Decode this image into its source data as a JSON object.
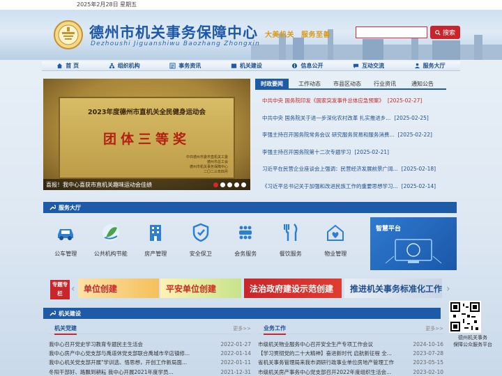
{
  "top": {
    "date": "2025年2月28日 星期五"
  },
  "header": {
    "title": "德州市机关事务保障中心",
    "pinyin": "Dezhoushi Jiguanshiwu Baozhang Zhongxin",
    "slogan1": "大美机关",
    "slogan2": "服务至善",
    "search_placeholder": "",
    "search_label": "搜索"
  },
  "nav": [
    {
      "label": "首 页",
      "icon": "home-icon"
    },
    {
      "label": "组织机构",
      "icon": "org-icon"
    },
    {
      "label": "事务资讯",
      "icon": "news-icon"
    },
    {
      "label": "机关建设",
      "icon": "book-icon"
    },
    {
      "label": "信息公开",
      "icon": "info-icon"
    },
    {
      "label": "互动交流",
      "icon": "chat-icon"
    },
    {
      "label": "服务大厅",
      "icon": "hall-icon"
    }
  ],
  "slider": {
    "plaque_title": "2023年度德州市直机关全民健身运动会",
    "plaque_award": "团体三等奖",
    "plaque_issuer": [
      "中共德州市委市直机关工委",
      "德州市总工会",
      "德州市机关事务保障中心",
      "二〇二三年四月"
    ],
    "caption": "喜报！我中心喜获市直机关趣味运动会佳绩",
    "dots": 5,
    "active_dot": 0
  },
  "news": {
    "tabs": [
      "时政要闻",
      "工作动态",
      "市县区动态",
      "行业资讯",
      "通知公告"
    ],
    "items": [
      {
        "title": "中共中央 国务院印发《国家突发事件总体应急预案》",
        "date": "[2025-02-27]"
      },
      {
        "title": "中共中央 国务院关于进一步深化农村改革 扎实推进乡...",
        "date": "[2025-02-25]"
      },
      {
        "title": "李强主持召开国务院常务会议 研究服务贸易和服务消费...",
        "date": "[2025-02-22]"
      },
      {
        "title": "李强主持召开国务院第十二次专题学习",
        "date": "[2025-02-21]"
      },
      {
        "title": "习近平在民营企业座谈会上强调：民营经济发展前景广阔...",
        "date": "[2025-02-18]"
      },
      {
        "title": "《习近平总书记关于加强和改进民族工作的重要思想学习...",
        "date": "[2025-02-14]"
      }
    ]
  },
  "service_hall": {
    "title": "服务大厅",
    "items": [
      {
        "label": "公车管理",
        "icon": "car-icon"
      },
      {
        "label": "公共机构节能",
        "icon": "energy-icon"
      },
      {
        "label": "房产管理",
        "icon": "building-icon"
      },
      {
        "label": "安全保卫",
        "icon": "shield-icon"
      },
      {
        "label": "会务服务",
        "icon": "meeting-icon"
      },
      {
        "label": "餐饮服务",
        "icon": "dining-icon"
      },
      {
        "label": "物业管理",
        "icon": "property-icon"
      }
    ],
    "smart_title": "智慧平台"
  },
  "banners": {
    "label": "专题专栏",
    "items": [
      "单位创建",
      "平安单位创建",
      "法治政府建设示范创建",
      "推进机关事务标准化工作"
    ]
  },
  "qr": {
    "label1": "德州机关事务",
    "label2": "保障公众服务平台"
  },
  "construction": {
    "title": "机关建设",
    "party": {
      "title": "机关党建",
      "more": "更多>>",
      "items": [
        {
          "title": "我中心召开党史学习教育专题民主生活会",
          "date": "2022-01-27"
        },
        {
          "title": "我中心房产中心党支部与禹道休党支部联合禹城市辛店镇修...",
          "date": "2022-01-14"
        },
        {
          "title": "我中心机关党支部开展\"学训选、悟思想，开创工作新局面...",
          "date": "2022-01-11"
        },
        {
          "title": "冬阳干部好、路飘到耕耘 我中心开展2021年度学员...",
          "date": "2021-12-31"
        }
      ]
    },
    "work": {
      "title": "业务工作",
      "more": "更多>>",
      "items": [
        {
          "title": "市级机关物业服务中心召开安全生产专项工作会议",
          "date": "2024-10-16"
        },
        {
          "title": "【学习贯彻党的二十大精神】奋进新时代 启航新征程 全...",
          "date": "2023-07-28"
        },
        {
          "title": "省机关事务管理局来我市调研行政事业单位房地产管理工作",
          "date": "2023-05-15"
        },
        {
          "title": "市级机关房产事务中心党支部召开2022年度组织生活会...",
          "date": "2023-02-10"
        }
      ]
    }
  }
}
